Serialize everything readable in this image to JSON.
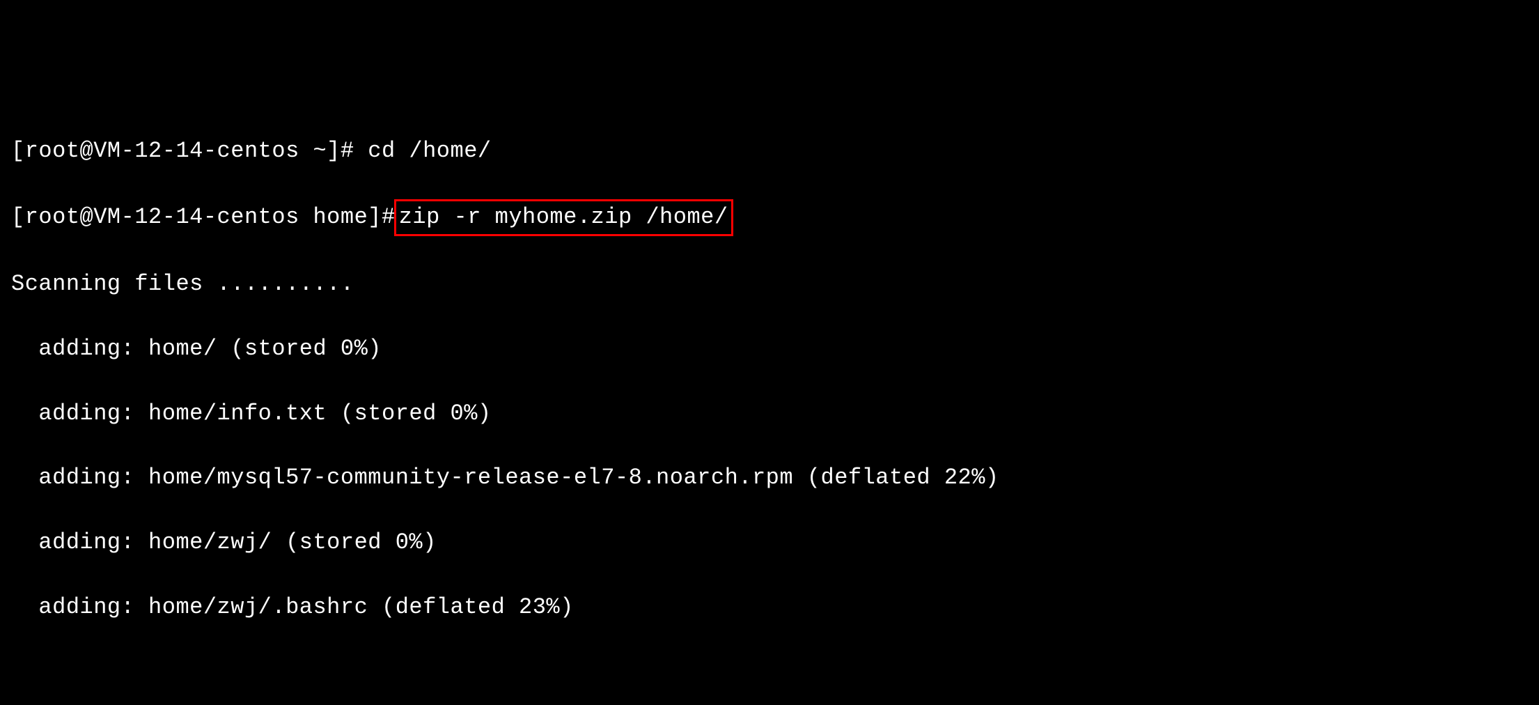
{
  "lines": [
    {
      "prompt": "[root@VM-12-14-centos ~]# ",
      "command": "cd /home/"
    },
    {
      "prompt": "[root@VM-12-14-centos home]#",
      "command": "zip -r myhome.zip /home/"
    }
  ],
  "output": {
    "scanning": "Scanning files ..........",
    "adding1": "  adding: home/ (stored 0%)",
    "adding2": "  adding: home/info.txt (stored 0%)",
    "adding3": "  adding: home/mysql57-community-release-el7-8.noarch.rpm (deflated 22%)",
    "adding4": "  adding: home/zwj/ (stored 0%)",
    "adding5": "  adding: home/zwj/.bashrc (deflated 23%)"
  }
}
